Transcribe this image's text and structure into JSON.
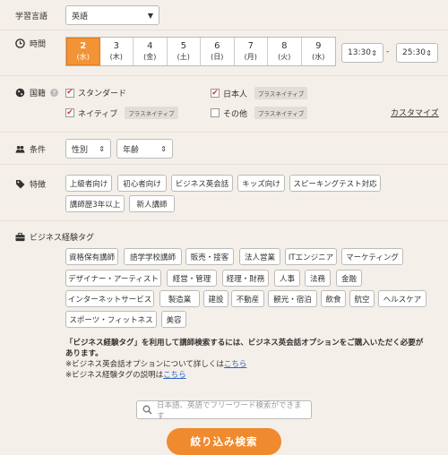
{
  "language": {
    "label": "学習言語",
    "value": "英語"
  },
  "time": {
    "label": "時間",
    "days": [
      {
        "num": "2",
        "wd": "(水)",
        "selected": true
      },
      {
        "num": "3",
        "wd": "(木)"
      },
      {
        "num": "4",
        "wd": "(金)"
      },
      {
        "num": "5",
        "wd": "(土)"
      },
      {
        "num": "6",
        "wd": "(日)"
      },
      {
        "num": "7",
        "wd": "(月)"
      },
      {
        "num": "8",
        "wd": "(火)"
      },
      {
        "num": "9",
        "wd": "(水)"
      }
    ],
    "start": "13:30",
    "end": "25:30",
    "separator": "-"
  },
  "nationality": {
    "label": "国籍",
    "standard": "スタンダード",
    "native": "ネイティブ",
    "japanese": "日本人",
    "other": "その他",
    "badge": "プラスネイティブ",
    "customize": "カスタマイズ"
  },
  "conditions": {
    "label": "条件",
    "gender": "性別",
    "age": "年齢"
  },
  "features": {
    "label": "特徴",
    "tags": [
      "上級者向け",
      "初心者向け",
      "ビジネス英会話",
      "キッズ向け",
      "スピーキングテスト対応",
      "講師歴3年以上",
      "新人講師"
    ]
  },
  "business": {
    "label": "ビジネス経験タグ",
    "tags": [
      "資格保有講師",
      "語学学校講師",
      "販売・接客",
      "法人営業",
      "ITエンジニア",
      "マーケティング",
      "デザイナー・アーティスト",
      "経営・管理",
      "経理・財務",
      "人事",
      "法務",
      "金融",
      "インターネットサービス",
      "製造業",
      "建設",
      "不動産",
      "観光・宿泊",
      "飲食",
      "航空",
      "ヘルスケア",
      "スポーツ・フィットネス",
      "美容"
    ],
    "notice_line1": "「ビジネス経験タグ」を利用して講師検索するには、ビジネス英会話オプションをご購入いただく必要が",
    "notice_line2": "あります。",
    "info1": "※ビジネス英会話オプションについて詳しくは",
    "info2": "※ビジネス経験タグの説明は",
    "link": "こちら"
  },
  "search": {
    "placeholder": "日本語、英語でフリーワード検索ができます"
  },
  "submit": "絞り込み検索",
  "colors": {
    "accent": "#f08a2e",
    "background": "#f4efe8",
    "link": "#2a66c9",
    "check": "#d33333"
  }
}
